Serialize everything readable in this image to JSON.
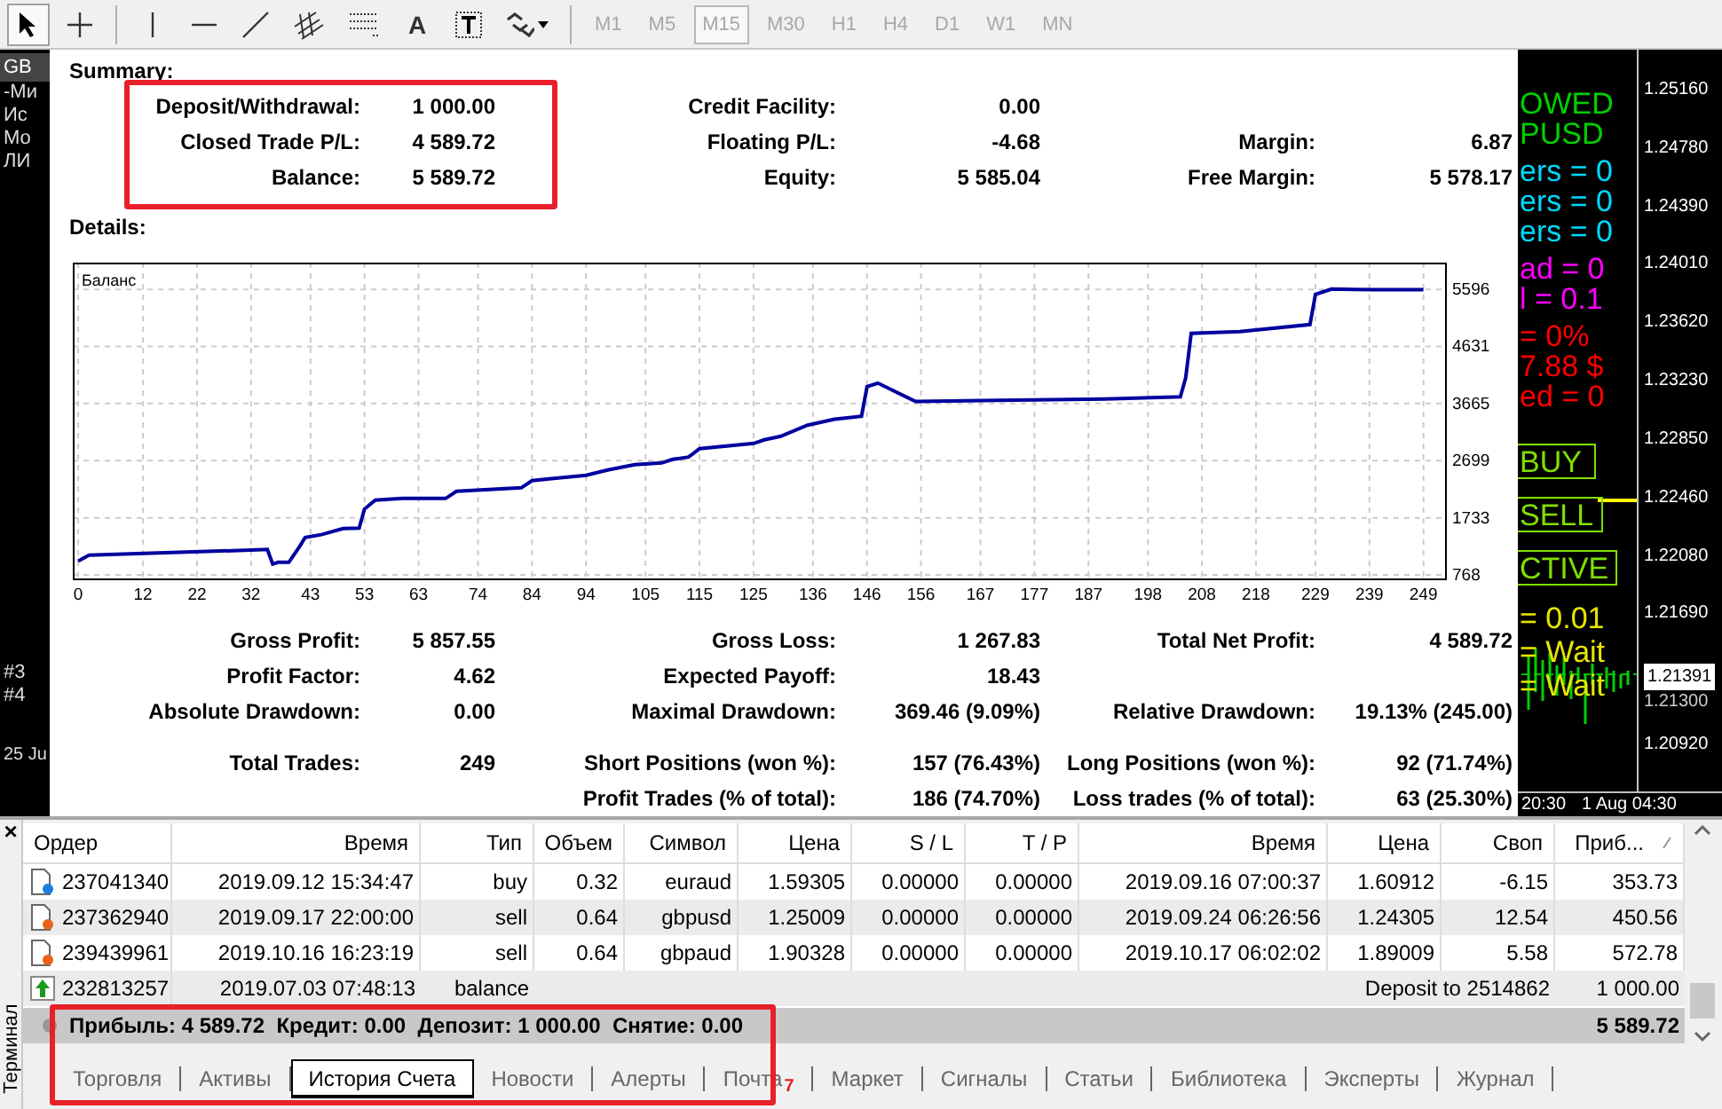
{
  "toolbar": {
    "tools": [
      {
        "kind": "cursor",
        "selected": true
      },
      {
        "kind": "crosshair",
        "selected": false
      },
      {
        "kind": "vertical_line",
        "selected": false
      },
      {
        "kind": "horizontal_line",
        "selected": false
      },
      {
        "kind": "trend_line",
        "selected": false
      },
      {
        "kind": "channel",
        "selected": false
      },
      {
        "kind": "fibonacci",
        "selected": false
      },
      {
        "kind": "text",
        "label": "A",
        "selected": false
      },
      {
        "kind": "label",
        "selected": false
      },
      {
        "kind": "arrows",
        "selected": false
      }
    ],
    "timeframes_disabled": true,
    "timeframes": [
      {
        "label": "M1",
        "selected": false
      },
      {
        "label": "M5",
        "selected": false
      },
      {
        "label": "M15",
        "selected": true
      },
      {
        "label": "M30",
        "selected": false
      },
      {
        "label": "H1",
        "selected": false
      },
      {
        "label": "H4",
        "selected": false
      },
      {
        "label": "D1",
        "selected": false
      },
      {
        "label": "W1",
        "selected": false
      },
      {
        "label": "MN",
        "selected": false
      }
    ]
  },
  "left_strip": {
    "labels": [
      "GB",
      "-Ми",
      "Ис",
      "Мо",
      "ЛИ"
    ],
    "markers": [
      "#3",
      "#4"
    ],
    "date": "25 Ju"
  },
  "report": {
    "summary_title": "Summary:",
    "summary": [
      {
        "left": {
          "label": "Deposit/Withdrawal:",
          "value": "1 000.00"
        },
        "middle": {
          "label": "Credit Facility:",
          "value": "0.00"
        }
      },
      {
        "left": {
          "label": "Closed Trade P/L:",
          "value": "4 589.72"
        },
        "middle": {
          "label": "Floating P/L:",
          "value": "-4.68"
        },
        "right": {
          "label": "Margin:",
          "value": "6.87"
        }
      },
      {
        "left": {
          "label": "Balance:",
          "value": "5 589.72"
        },
        "middle": {
          "label": "Equity:",
          "value": "5 585.04"
        },
        "right": {
          "label": "Free Margin:",
          "value": "5 578.17"
        }
      }
    ],
    "details_title": "Details:",
    "chart_data": {
      "type": "line",
      "grid": true,
      "xlim": [
        -1,
        253
      ],
      "ylim": [
        708,
        6048
      ],
      "xticks": [
        0,
        12,
        22,
        32,
        43,
        53,
        63,
        74,
        84,
        94,
        105,
        115,
        125,
        136,
        146,
        156,
        167,
        177,
        187,
        198,
        208,
        218,
        229,
        239,
        249
      ],
      "yticks": [
        768,
        1733,
        2699,
        3665,
        4631,
        5596
      ],
      "x": [
        0,
        2,
        33,
        35,
        36,
        37,
        39,
        41,
        42,
        45,
        49,
        52,
        53,
        55,
        60,
        68,
        70,
        82,
        84,
        88,
        94,
        98,
        103,
        108,
        110,
        113,
        115,
        125,
        127,
        130,
        135,
        140,
        145,
        146,
        148,
        155,
        170,
        190,
        204,
        205,
        206,
        215,
        228,
        229,
        232,
        240,
        249
      ],
      "series": [
        {
          "name": "Баланс",
          "color": "#0000a0",
          "values": [
            1000,
            1100,
            1190,
            1200,
            950,
            980,
            980,
            1250,
            1400,
            1450,
            1550,
            1560,
            1880,
            2030,
            2060,
            2060,
            2180,
            2240,
            2360,
            2400,
            2450,
            2540,
            2630,
            2660,
            2720,
            2760,
            2900,
            2990,
            3050,
            3110,
            3300,
            3400,
            3450,
            3950,
            4010,
            3700,
            3720,
            3740,
            3780,
            4100,
            4850,
            4880,
            5000,
            5510,
            5600,
            5590,
            5590
          ]
        }
      ]
    },
    "stats": [
      {
        "left": {
          "label": "Gross Profit:",
          "value": "5 857.55"
        },
        "middle": {
          "label": "Gross Loss:",
          "value": "1 267.83"
        },
        "right": {
          "label": "Total Net Profit:",
          "value": "4 589.72"
        }
      },
      {
        "left": {
          "label": "Profit Factor:",
          "value": "4.62"
        },
        "middle": {
          "label": "Expected Payoff:",
          "value": "18.43"
        }
      },
      {
        "left": {
          "label": "Absolute Drawdown:",
          "value": "0.00"
        },
        "middle": {
          "label": "Maximal Drawdown:",
          "value": "369.46 (9.09%)"
        },
        "right": {
          "label": "Relative Drawdown:",
          "value": "19.13% (245.00)"
        }
      }
    ],
    "positions": [
      {
        "left": {
          "label": "Total Trades:",
          "value": "249"
        },
        "middle": {
          "label": "Short Positions (won %):",
          "value": "157 (76.43%)"
        },
        "right": {
          "label": "Long Positions (won %):",
          "value": "92 (71.74%)"
        }
      },
      {
        "middle": {
          "label": "Profit Trades (% of total):",
          "value": "186 (74.70%)"
        },
        "right": {
          "label": "Loss trades (% of total):",
          "value": "63 (25.30%)"
        }
      }
    ]
  },
  "right_strip": {
    "labels": [
      {
        "kind": "text",
        "text": "OWED",
        "color": "#00d000"
      },
      {
        "kind": "text",
        "text": "PUSD",
        "color": "#00d000"
      },
      {
        "kind": "text",
        "text": "ers = 0",
        "color": "#00d8ff"
      },
      {
        "kind": "text",
        "text": "ers = 0",
        "color": "#00d8ff"
      },
      {
        "kind": "text",
        "text": "ers = 0",
        "color": "#00d8ff"
      },
      {
        "kind": "text",
        "text": "ad =  0",
        "color": "#ff00ff"
      },
      {
        "kind": "text",
        "text": "l = 0.1",
        "color": "#ff00ff"
      },
      {
        "kind": "text",
        "text": "= 0%",
        "color": "#ff0000"
      },
      {
        "kind": "text",
        "text": "7.88 $",
        "color": "#ff0000"
      },
      {
        "kind": "text",
        "text": "ed = 0",
        "color": "#ff0000"
      },
      {
        "kind": "button",
        "text": "BUY",
        "color": "#7fe000"
      },
      {
        "kind": "button",
        "text": "SELL",
        "color": "#7fe000"
      },
      {
        "kind": "button",
        "text": "CTIVE",
        "color": "#7fe000"
      },
      {
        "kind": "text",
        "text": "= 0.01",
        "color": "#e6e600"
      },
      {
        "kind": "text",
        "text": "= Wait",
        "color": "#e6e600"
      },
      {
        "kind": "text",
        "text": "= Wait",
        "color": "#e6e600"
      }
    ]
  },
  "price_axis": {
    "labels": [
      {
        "kind": "tick",
        "text": "1.25160"
      },
      {
        "kind": "tick",
        "text": "1.24780"
      },
      {
        "kind": "tick",
        "text": "1.24390"
      },
      {
        "kind": "tick",
        "text": "1.24010"
      },
      {
        "kind": "tick",
        "text": "1.23620"
      },
      {
        "kind": "tick",
        "text": "1.23230"
      },
      {
        "kind": "tick",
        "text": "1.22850"
      },
      {
        "kind": "tick",
        "text": "1.22460"
      },
      {
        "kind": "tick",
        "text": "1.22080"
      },
      {
        "kind": "tick",
        "text": "1.21690"
      },
      {
        "kind": "current",
        "text": "1.21391"
      },
      {
        "kind": "tick",
        "text": "1.21300"
      },
      {
        "kind": "tick",
        "text": "1.20920"
      }
    ],
    "time_labels": [
      "20:30",
      "1 Aug 04:30"
    ]
  },
  "terminal": {
    "title": "Терминал",
    "close": "×",
    "columns": [
      {
        "label": "Ордер",
        "sorted": false
      },
      {
        "label": "Время",
        "sorted": false
      },
      {
        "label": "Тип",
        "sorted": false
      },
      {
        "label": "Объем",
        "sorted": false
      },
      {
        "label": "Символ",
        "sorted": false
      },
      {
        "label": "Цена",
        "sorted": false
      },
      {
        "label": "S / L",
        "sorted": false
      },
      {
        "label": "T / P",
        "sorted": false
      },
      {
        "label": "Время",
        "sorted": false
      },
      {
        "label": "Цена",
        "sorted": false
      },
      {
        "label": "Своп",
        "sorted": false
      },
      {
        "label": "Приб...",
        "sorted": true
      }
    ],
    "rows": [
      {
        "kind": "buy",
        "cells": [
          "237041340",
          "2019.09.12 15:34:47",
          "buy",
          "0.32",
          "euraud",
          "1.59305",
          "0.00000",
          "0.00000",
          "2019.09.16 07:00:37",
          "1.60912",
          "-6.15",
          "353.73"
        ]
      },
      {
        "kind": "sell",
        "cells": [
          "237362940",
          "2019.09.17 22:00:00",
          "sell",
          "0.64",
          "gbpusd",
          "1.25009",
          "0.00000",
          "0.00000",
          "2019.09.24 06:26:56",
          "1.24305",
          "12.54",
          "450.56"
        ]
      },
      {
        "kind": "sell",
        "cells": [
          "239439961",
          "2019.10.16 16:23:19",
          "sell",
          "0.64",
          "gbpaud",
          "1.90328",
          "0.00000",
          "0.00000",
          "2019.10.17 06:02:02",
          "1.89009",
          "5.58",
          "572.78"
        ]
      },
      {
        "kind": "balance",
        "cells": [
          "232813257",
          "2019.07.03 07:48:13",
          "balance",
          "",
          "",
          "",
          "",
          "",
          "",
          "",
          "Deposit to 2514862",
          "1 000.00"
        ]
      }
    ],
    "totals": {
      "text": "Прибыль: 4 589.72  Кредит: 0.00  Депозит: 1 000.00  Снятие: 0.00",
      "total": "5 589.72"
    },
    "tabs": [
      {
        "label": "Торговля",
        "selected": false
      },
      {
        "label": "Активы",
        "selected": false
      },
      {
        "label": "История Счета",
        "selected": true
      },
      {
        "label": "Новости",
        "selected": false
      },
      {
        "label": "Алерты",
        "selected": false
      },
      {
        "label": "Почта",
        "selected": false,
        "badge": "7"
      },
      {
        "label": "Маркет",
        "selected": false
      },
      {
        "label": "Сигналы",
        "selected": false
      },
      {
        "label": "Статьи",
        "selected": false
      },
      {
        "label": "Библиотека",
        "selected": false
      },
      {
        "label": "Эксперты",
        "selected": false
      },
      {
        "label": "Журнал",
        "selected": false
      }
    ]
  },
  "annotations": [
    {
      "kind": "frame"
    },
    {
      "kind": "frame"
    }
  ]
}
